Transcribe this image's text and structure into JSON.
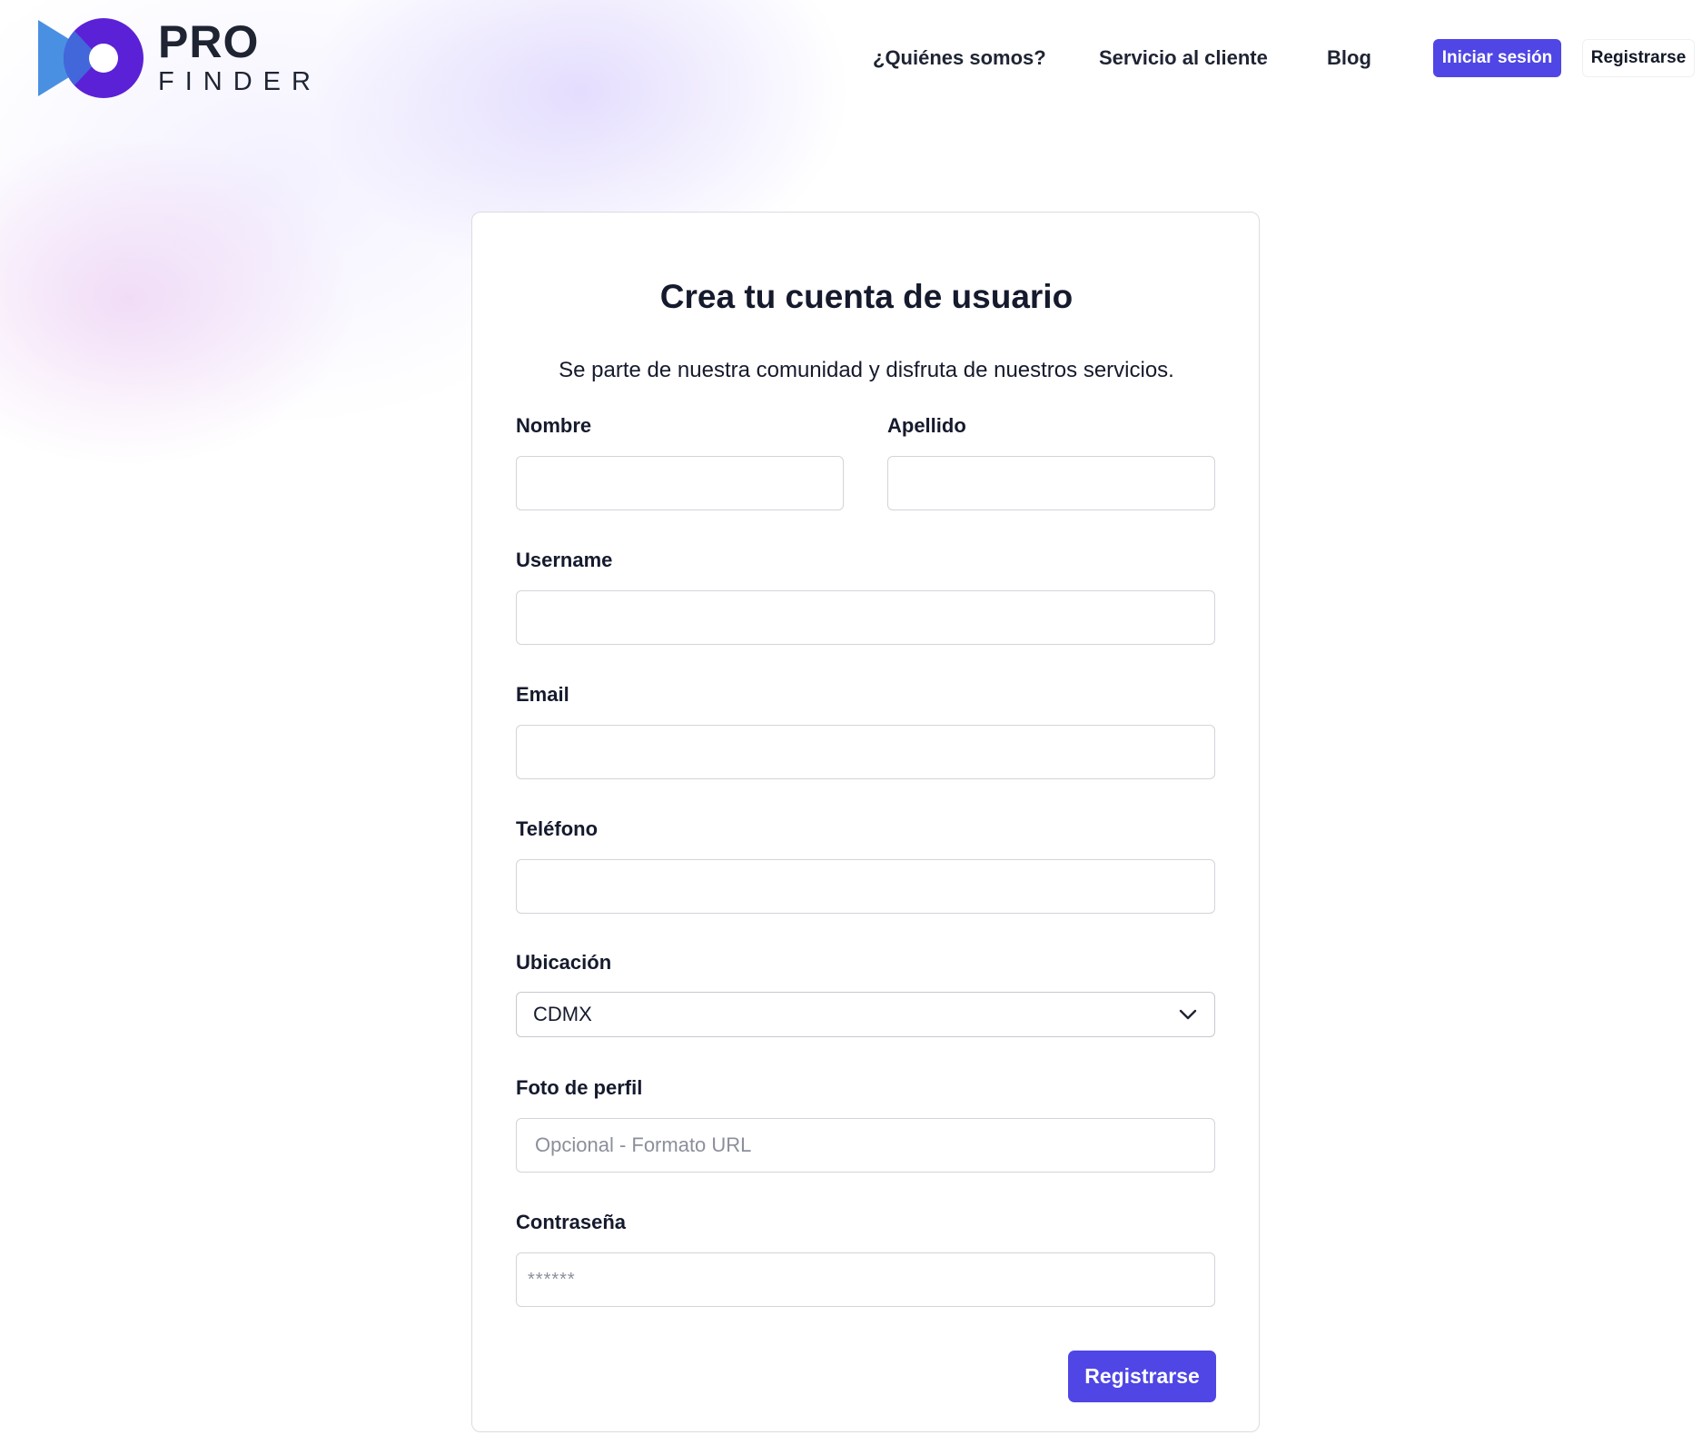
{
  "brand": {
    "name_top": "PRO",
    "name_bottom": "FINDER",
    "colors": {
      "primary": "#4f46e5",
      "logo_purple": "#5b21d6",
      "logo_blue": "#4a90e2"
    }
  },
  "nav": {
    "about": "¿Quiénes somos?",
    "support": "Servicio al cliente",
    "blog": "Blog",
    "login": "Iniciar sesión",
    "register": "Registrarse"
  },
  "form": {
    "title": "Crea tu cuenta de usuario",
    "subtitle": "Se parte de nuestra comunidad y disfruta de nuestros servicios.",
    "fields": {
      "first_name": {
        "label": "Nombre",
        "value": ""
      },
      "last_name": {
        "label": "Apellido",
        "value": ""
      },
      "username": {
        "label": "Username",
        "value": ""
      },
      "email": {
        "label": "Email",
        "value": ""
      },
      "phone": {
        "label": "Teléfono",
        "value": ""
      },
      "location": {
        "label": "Ubicación",
        "selected": "CDMX"
      },
      "photo": {
        "label": "Foto de perfil",
        "placeholder": "Opcional - Formato URL"
      },
      "password": {
        "label": "Contraseña",
        "placeholder": "******"
      }
    },
    "submit_label": "Registrarse"
  }
}
